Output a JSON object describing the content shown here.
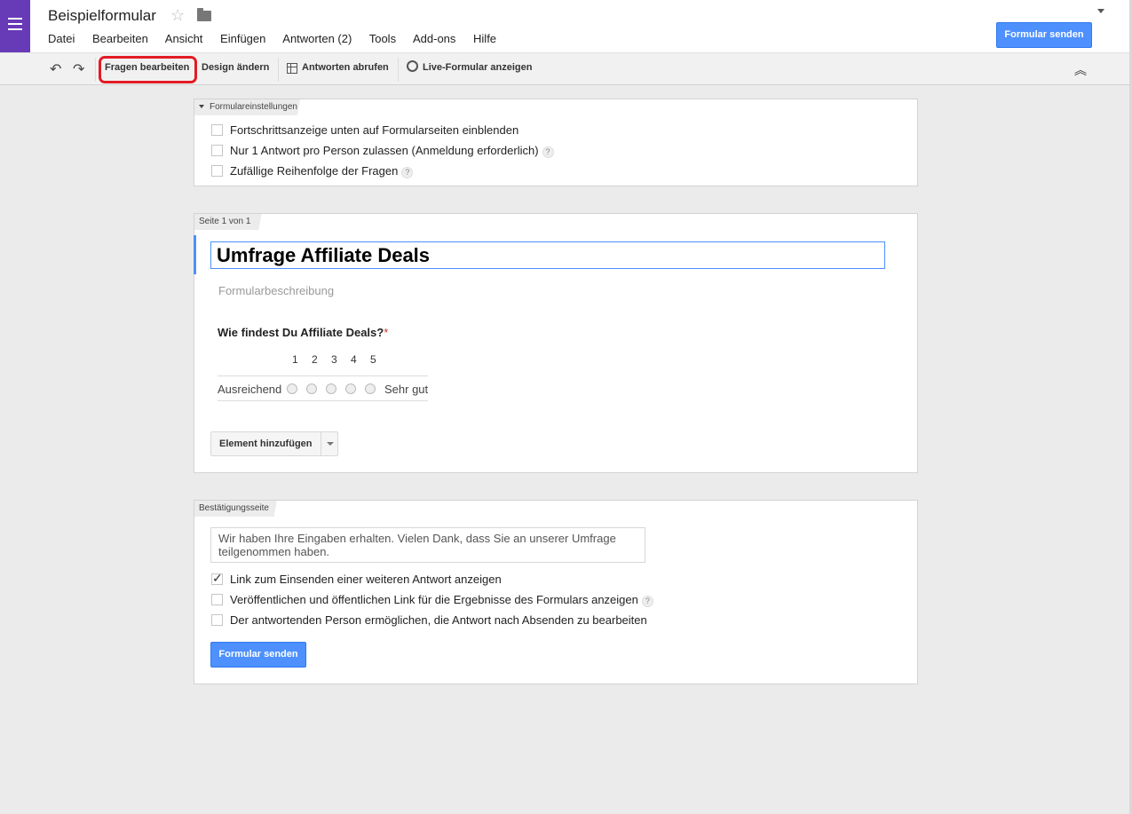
{
  "app": {
    "doc_title": "Beispielformular",
    "menu": [
      "Datei",
      "Bearbeiten",
      "Ansicht",
      "Einfügen",
      "Antworten (2)",
      "Tools",
      "Add-ons",
      "Hilfe"
    ],
    "send_label": "Formular senden"
  },
  "toolbar": {
    "edit_questions": "Fragen bearbeiten",
    "change_design": "Design ändern",
    "view_responses": "Antworten abrufen",
    "live_form": "Live-Formular anzeigen"
  },
  "settings": {
    "tab_label": "Formulareinstellungen",
    "options": [
      {
        "label": "Fortschrittsanzeige unten auf Formularseiten einblenden",
        "checked": false,
        "help": false
      },
      {
        "label": "Nur 1 Antwort pro Person zulassen (Anmeldung erforderlich)",
        "checked": false,
        "help": true
      },
      {
        "label": "Zufällige Reihenfolge der Fragen",
        "checked": false,
        "help": true
      }
    ]
  },
  "page": {
    "tab_label": "Seite 1 von 1",
    "form_title": "Umfrage Affiliate Deals",
    "description_placeholder": "Formularbeschreibung",
    "question": {
      "title": "Wie findest Du Affiliate Deals?",
      "required_mark": "*",
      "scale": [
        "1",
        "2",
        "3",
        "4",
        "5"
      ],
      "low_label": "Ausreichend",
      "high_label": "Sehr gut"
    },
    "add_item_label": "Element hinzufügen"
  },
  "confirmation": {
    "tab_label": "Bestätigungsseite",
    "message": "Wir haben Ihre Eingaben erhalten. Vielen Dank, dass Sie an unserer Umfrage teilgenommen haben.",
    "options": [
      {
        "label": "Link zum Einsenden einer weiteren Antwort anzeigen",
        "checked": true,
        "help": false
      },
      {
        "label": "Veröffentlichen und öffentlichen Link für die Ergebnisse des Formulars anzeigen",
        "checked": false,
        "help": true
      },
      {
        "label": "Der antwortenden Person ermöglichen, die Antwort nach Absenden zu bearbeiten",
        "checked": false,
        "help": false
      }
    ],
    "send_label": "Formular senden"
  },
  "colors": {
    "accent": "#4d90fe",
    "app_icon": "#673ab7",
    "highlight": "#e31b23"
  }
}
